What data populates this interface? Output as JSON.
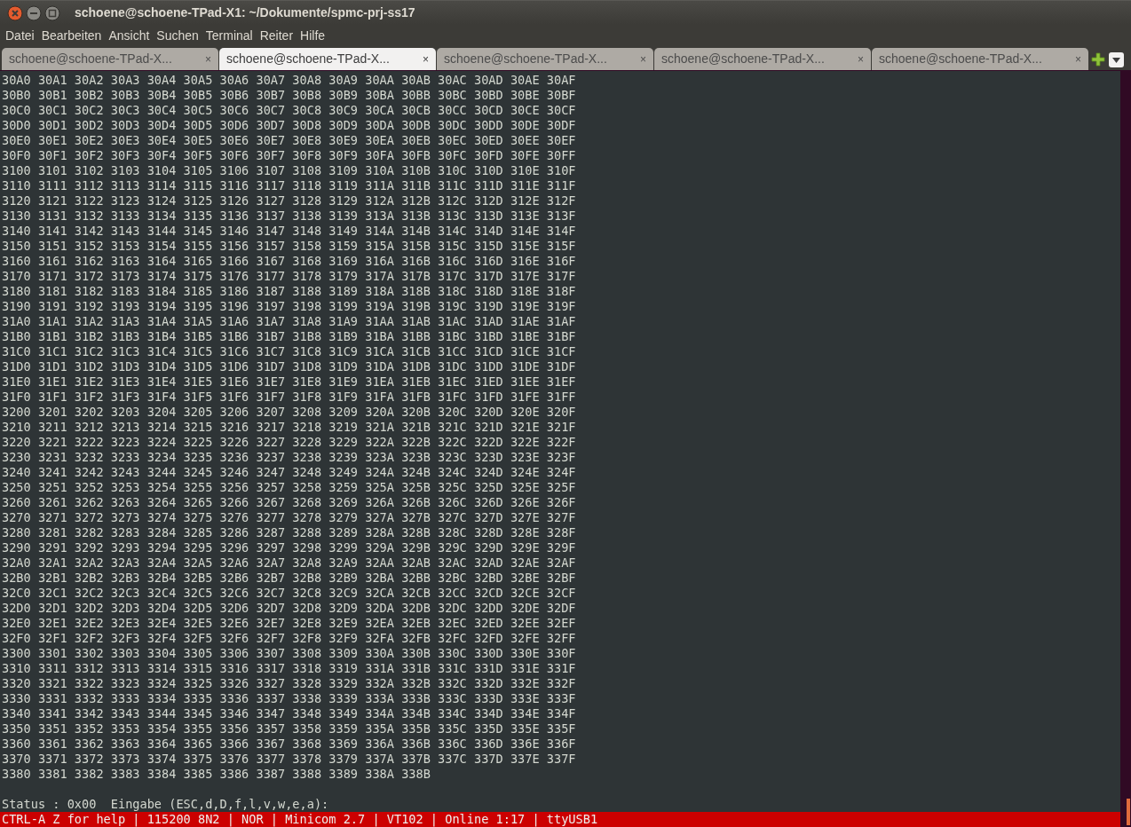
{
  "window": {
    "title": "schoene@schoene-TPad-X1: ~/Dokumente/spmc-prj-ss17"
  },
  "menu": [
    "Datei",
    "Bearbeiten",
    "Ansicht",
    "Suchen",
    "Terminal",
    "Reiter",
    "Hilfe"
  ],
  "tabs": [
    {
      "label": "schoene@schoene-TPad-X...",
      "close": "×",
      "selected": false
    },
    {
      "label": "schoene@schoene-TPad-X...",
      "close": "×",
      "selected": true
    },
    {
      "label": "schoene@schoene-TPad-X...",
      "close": "×",
      "selected": false
    },
    {
      "label": "schoene@schoene-TPad-X...",
      "close": "×",
      "selected": false
    },
    {
      "label": "schoene@schoene-TPad-X...",
      "close": "×",
      "selected": false
    }
  ],
  "terminal": {
    "lines": [
      "30A0 30A1 30A2 30A3 30A4 30A5 30A6 30A7 30A8 30A9 30AA 30AB 30AC 30AD 30AE 30AF",
      "30B0 30B1 30B2 30B3 30B4 30B5 30B6 30B7 30B8 30B9 30BA 30BB 30BC 30BD 30BE 30BF",
      "30C0 30C1 30C2 30C3 30C4 30C5 30C6 30C7 30C8 30C9 30CA 30CB 30CC 30CD 30CE 30CF",
      "30D0 30D1 30D2 30D3 30D4 30D5 30D6 30D7 30D8 30D9 30DA 30DB 30DC 30DD 30DE 30DF",
      "30E0 30E1 30E2 30E3 30E4 30E5 30E6 30E7 30E8 30E9 30EA 30EB 30EC 30ED 30EE 30EF",
      "30F0 30F1 30F2 30F3 30F4 30F5 30F6 30F7 30F8 30F9 30FA 30FB 30FC 30FD 30FE 30FF",
      "3100 3101 3102 3103 3104 3105 3106 3107 3108 3109 310A 310B 310C 310D 310E 310F",
      "3110 3111 3112 3113 3114 3115 3116 3117 3118 3119 311A 311B 311C 311D 311E 311F",
      "3120 3121 3122 3123 3124 3125 3126 3127 3128 3129 312A 312B 312C 312D 312E 312F",
      "3130 3131 3132 3133 3134 3135 3136 3137 3138 3139 313A 313B 313C 313D 313E 313F",
      "3140 3141 3142 3143 3144 3145 3146 3147 3148 3149 314A 314B 314C 314D 314E 314F",
      "3150 3151 3152 3153 3154 3155 3156 3157 3158 3159 315A 315B 315C 315D 315E 315F",
      "3160 3161 3162 3163 3164 3165 3166 3167 3168 3169 316A 316B 316C 316D 316E 316F",
      "3170 3171 3172 3173 3174 3175 3176 3177 3178 3179 317A 317B 317C 317D 317E 317F",
      "3180 3181 3182 3183 3184 3185 3186 3187 3188 3189 318A 318B 318C 318D 318E 318F",
      "3190 3191 3192 3193 3194 3195 3196 3197 3198 3199 319A 319B 319C 319D 319E 319F",
      "31A0 31A1 31A2 31A3 31A4 31A5 31A6 31A7 31A8 31A9 31AA 31AB 31AC 31AD 31AE 31AF",
      "31B0 31B1 31B2 31B3 31B4 31B5 31B6 31B7 31B8 31B9 31BA 31BB 31BC 31BD 31BE 31BF",
      "31C0 31C1 31C2 31C3 31C4 31C5 31C6 31C7 31C8 31C9 31CA 31CB 31CC 31CD 31CE 31CF",
      "31D0 31D1 31D2 31D3 31D4 31D5 31D6 31D7 31D8 31D9 31DA 31DB 31DC 31DD 31DE 31DF",
      "31E0 31E1 31E2 31E3 31E4 31E5 31E6 31E7 31E8 31E9 31EA 31EB 31EC 31ED 31EE 31EF",
      "31F0 31F1 31F2 31F3 31F4 31F5 31F6 31F7 31F8 31F9 31FA 31FB 31FC 31FD 31FE 31FF",
      "3200 3201 3202 3203 3204 3205 3206 3207 3208 3209 320A 320B 320C 320D 320E 320F",
      "3210 3211 3212 3213 3214 3215 3216 3217 3218 3219 321A 321B 321C 321D 321E 321F",
      "3220 3221 3222 3223 3224 3225 3226 3227 3228 3229 322A 322B 322C 322D 322E 322F",
      "3230 3231 3232 3233 3234 3235 3236 3237 3238 3239 323A 323B 323C 323D 323E 323F",
      "3240 3241 3242 3243 3244 3245 3246 3247 3248 3249 324A 324B 324C 324D 324E 324F",
      "3250 3251 3252 3253 3254 3255 3256 3257 3258 3259 325A 325B 325C 325D 325E 325F",
      "3260 3261 3262 3263 3264 3265 3266 3267 3268 3269 326A 326B 326C 326D 326E 326F",
      "3270 3271 3272 3273 3274 3275 3276 3277 3278 3279 327A 327B 327C 327D 327E 327F",
      "3280 3281 3282 3283 3284 3285 3286 3287 3288 3289 328A 328B 328C 328D 328E 328F",
      "3290 3291 3292 3293 3294 3295 3296 3297 3298 3299 329A 329B 329C 329D 329E 329F",
      "32A0 32A1 32A2 32A3 32A4 32A5 32A6 32A7 32A8 32A9 32AA 32AB 32AC 32AD 32AE 32AF",
      "32B0 32B1 32B2 32B3 32B4 32B5 32B6 32B7 32B8 32B9 32BA 32BB 32BC 32BD 32BE 32BF",
      "32C0 32C1 32C2 32C3 32C4 32C5 32C6 32C7 32C8 32C9 32CA 32CB 32CC 32CD 32CE 32CF",
      "32D0 32D1 32D2 32D3 32D4 32D5 32D6 32D7 32D8 32D9 32DA 32DB 32DC 32DD 32DE 32DF",
      "32E0 32E1 32E2 32E3 32E4 32E5 32E6 32E7 32E8 32E9 32EA 32EB 32EC 32ED 32EE 32EF",
      "32F0 32F1 32F2 32F3 32F4 32F5 32F6 32F7 32F8 32F9 32FA 32FB 32FC 32FD 32FE 32FF",
      "3300 3301 3302 3303 3304 3305 3306 3307 3308 3309 330A 330B 330C 330D 330E 330F",
      "3310 3311 3312 3313 3314 3315 3316 3317 3318 3319 331A 331B 331C 331D 331E 331F",
      "3320 3321 3322 3323 3324 3325 3326 3327 3328 3329 332A 332B 332C 332D 332E 332F",
      "3330 3331 3332 3333 3334 3335 3336 3337 3338 3339 333A 333B 333C 333D 333E 333F",
      "3340 3341 3342 3343 3344 3345 3346 3347 3348 3349 334A 334B 334C 334D 334E 334F",
      "3350 3351 3352 3353 3354 3355 3356 3357 3358 3359 335A 335B 335C 335D 335E 335F",
      "3360 3361 3362 3363 3364 3365 3366 3367 3368 3369 336A 336B 336C 336D 336E 336F",
      "3370 3371 3372 3373 3374 3375 3376 3377 3378 3379 337A 337B 337C 337D 337E 337F",
      "3380 3381 3382 3383 3384 3385 3386 3387 3388 3389 338A 338B"
    ],
    "prompt": "Status : 0x00  Eingabe (ESC,d,D,f,l,v,w,e,a):",
    "status_bar": "CTRL-A Z for help | 115200 8N2 | NOR | Minicom 2.7 | VT102 | Online 1:17 | ttyUSB1"
  }
}
